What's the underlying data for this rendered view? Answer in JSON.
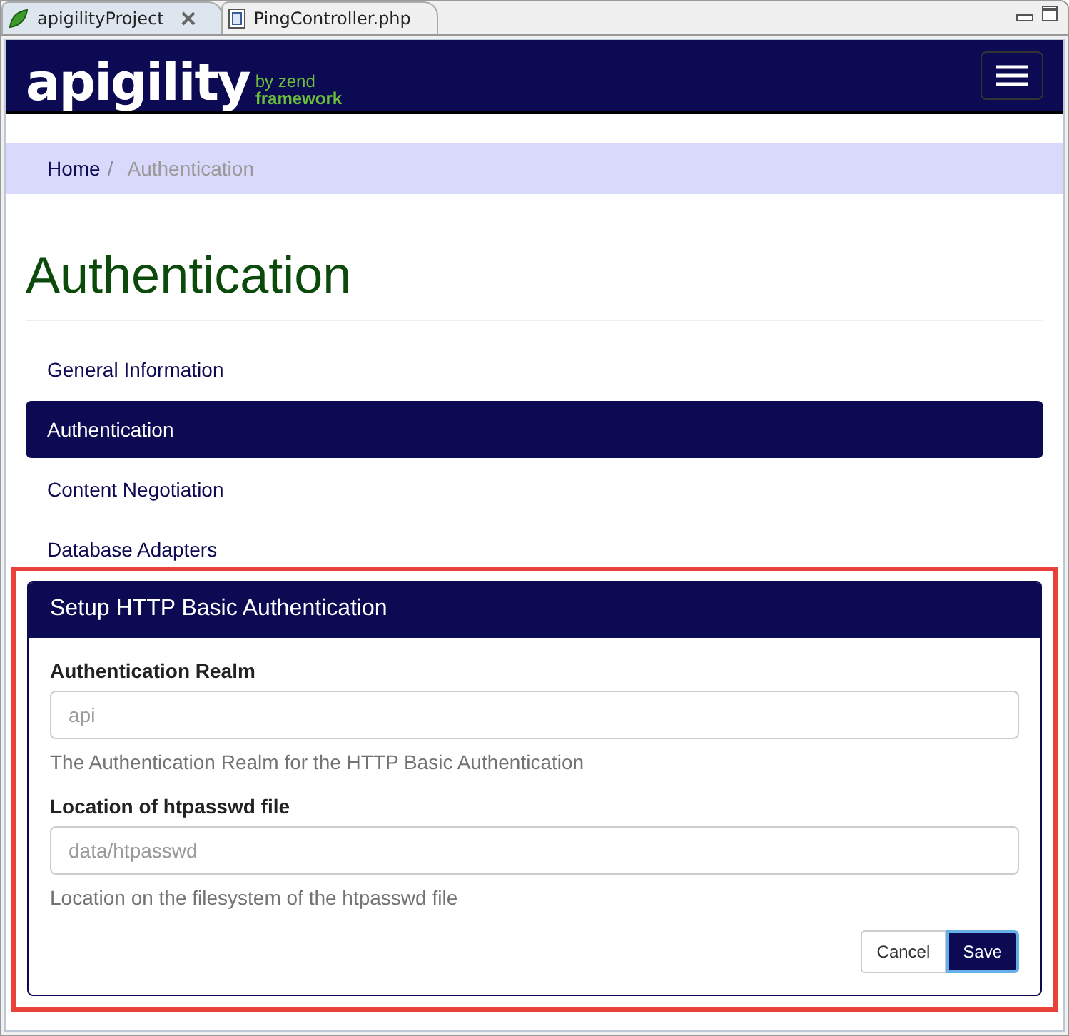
{
  "editor_tabs": [
    {
      "label": "apigilityProject",
      "kind": "project",
      "selected": true,
      "closable": true
    },
    {
      "label": "PingController.php",
      "kind": "file",
      "selected": false,
      "closable": false
    }
  ],
  "navbar": {
    "logo": "apigility",
    "tagline_1": "by zend",
    "tagline_2": "framework"
  },
  "breadcrumb": [
    {
      "label": "Home",
      "selected": false
    },
    {
      "label": "Authentication",
      "selected": true
    }
  ],
  "breadcrumb_separator": "/",
  "title": "Authentication",
  "nav": [
    {
      "label": "General Information",
      "selected": false
    },
    {
      "label": "Authentication",
      "selected": true
    },
    {
      "label": "Content Negotiation",
      "selected": false
    },
    {
      "label": "Database Adapters",
      "selected": false
    }
  ],
  "panel": {
    "title": "Setup HTTP Basic Authentication",
    "fields": [
      {
        "label": "Authentication Realm",
        "placeholder": "api",
        "help": "The Authentication Realm for the HTTP Basic Authentication"
      },
      {
        "label": "Location of htpasswd file",
        "placeholder": "data/htpasswd",
        "help": "Location on the filesystem of the htpasswd file"
      }
    ],
    "buttons": [
      {
        "label": "Cancel",
        "kind": "default"
      },
      {
        "label": "Save",
        "kind": "primary"
      }
    ]
  }
}
